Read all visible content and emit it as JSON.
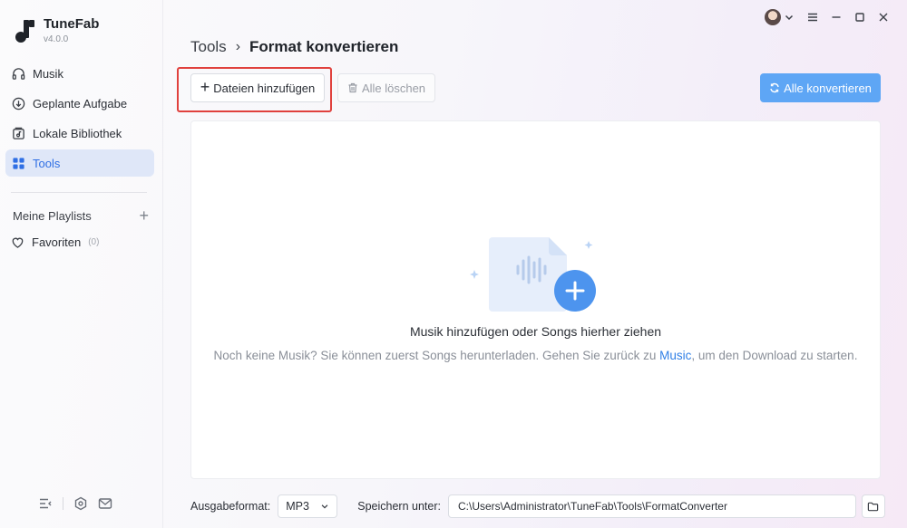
{
  "app": {
    "name": "TuneFab",
    "version": "v4.0.0"
  },
  "sidebar": {
    "items": [
      {
        "label": "Musik",
        "icon": "headphones-icon"
      },
      {
        "label": "Geplante Aufgabe",
        "icon": "download-circle-icon"
      },
      {
        "label": "Lokale Bibliothek",
        "icon": "library-icon"
      },
      {
        "label": "Tools",
        "icon": "grid-icon",
        "active": true
      }
    ],
    "playlists_label": "Meine Playlists",
    "favorites_label": "Favoriten",
    "favorites_count": "(0)"
  },
  "breadcrumb": {
    "parent": "Tools",
    "separator": "›",
    "current": "Format konvertieren"
  },
  "toolbar": {
    "add_label": "Dateien hinzufügen",
    "clear_label": "Alle löschen",
    "convert_label": "Alle konvertieren"
  },
  "dropzone": {
    "title": "Musik hinzufügen oder Songs hierher ziehen",
    "hint_before": "Noch keine Musik? Sie können zuerst Songs herunterladen. Gehen Sie zurück zu ",
    "hint_link": "Music",
    "hint_after": ", um den Download zu starten."
  },
  "bottom": {
    "format_label": "Ausgabeformat:",
    "format_value": "MP3",
    "save_label": "Speichern unter:",
    "save_path": "C:\\Users\\Administrator\\TuneFab\\Tools\\FormatConverter"
  },
  "colors": {
    "accent": "#2f6fe4",
    "convert_button": "#5ea6f5",
    "highlight": "#e0413d"
  }
}
